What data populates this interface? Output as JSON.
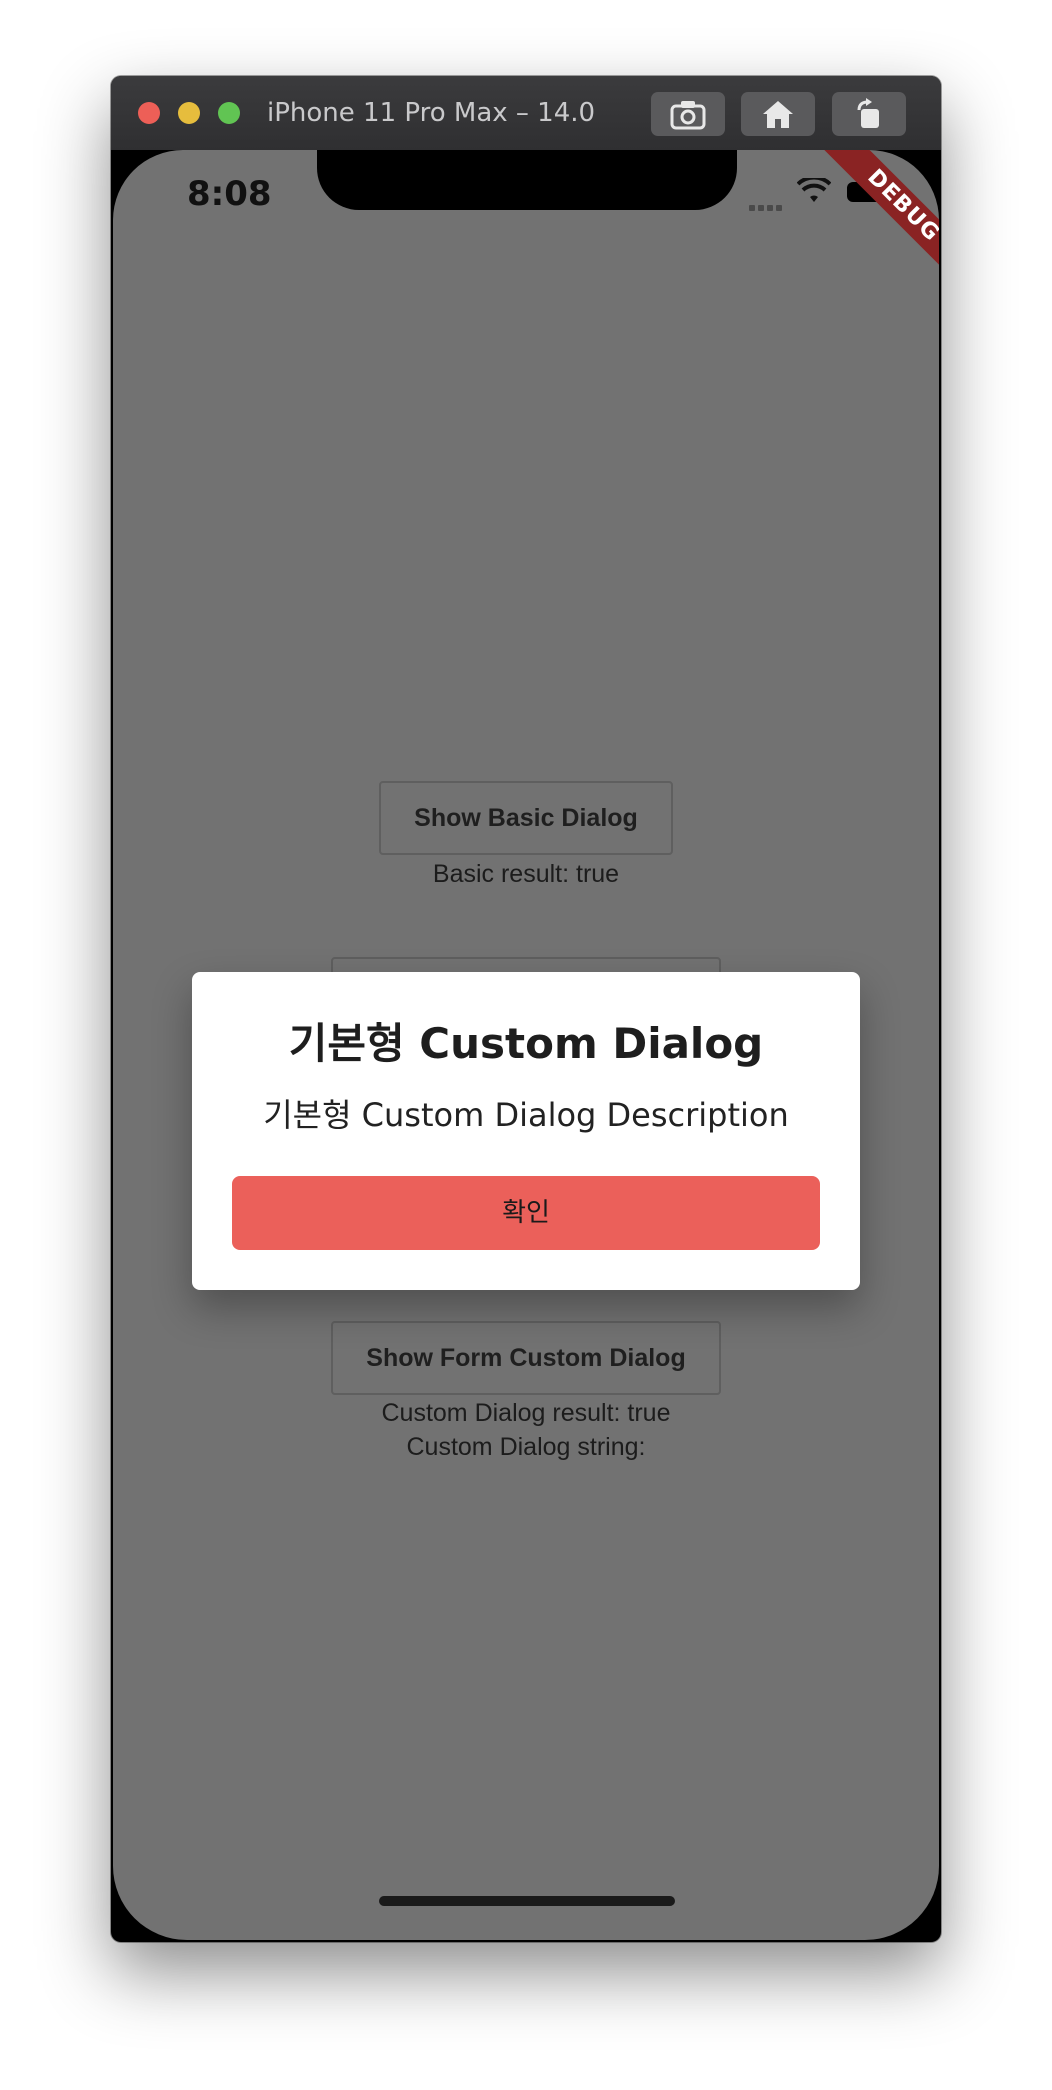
{
  "window": {
    "title": "iPhone 11 Pro Max – 14.0"
  },
  "status_bar": {
    "time": "8:08"
  },
  "debug_banner": {
    "label": "DEBUG",
    "color": "#8a2323"
  },
  "main": {
    "basic_button_label": "Show Basic Dialog",
    "basic_result": "Basic result: true",
    "form_button_label": "Show Form Custom Dialog",
    "custom_result": "Custom Dialog result: true",
    "custom_string": "Custom Dialog string:"
  },
  "dialog": {
    "title": "기본형 Custom Dialog",
    "description": "기본형 Custom Dialog Description",
    "confirm_label": "확인",
    "confirm_color": "#eb605a"
  },
  "colors": {
    "scrim": "#727272",
    "dialog_bg": "#ffffff"
  },
  "icons": [
    "screenshot-icon",
    "home-icon",
    "rotate-icon",
    "wifi-icon",
    "battery-icon",
    "cellular-signal-icon"
  ]
}
